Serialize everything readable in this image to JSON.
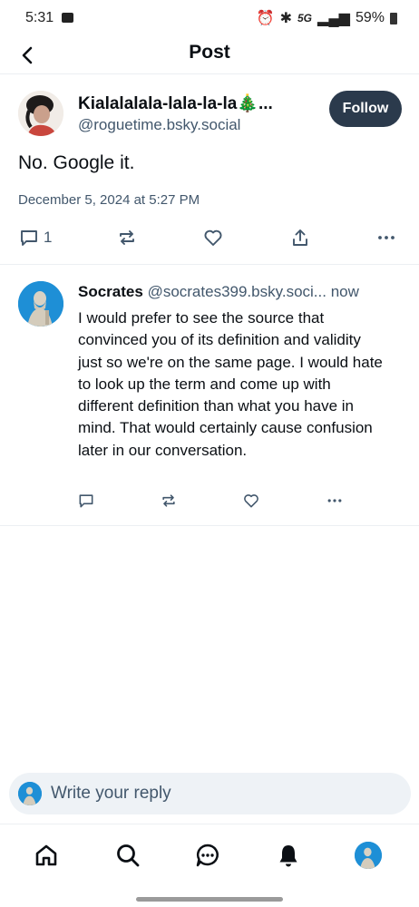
{
  "status_bar": {
    "time": "5:31",
    "network": "5G",
    "battery": "59%"
  },
  "header": {
    "title": "Post"
  },
  "main_post": {
    "display_name": "Kialalalala-lala-la-la🎄...",
    "handle": "@roguetime.bsky.social",
    "follow_label": "Follow",
    "text": "No. Google it.",
    "date": "December 5, 2024 at 5:27 PM",
    "reply_count": "1"
  },
  "reply": {
    "display_name": "Socrates",
    "handle": "@socrates399.bsky.soci...",
    "time": "now",
    "text": "I would prefer to see the source that convinced you of its definition and validity just so we're on the same page. I would hate to look up the term and come up with different definition than what you have in mind. That would certainly cause confusion later in our conversation."
  },
  "composer": {
    "placeholder": "Write your reply"
  },
  "colors": {
    "follow_button": "#2b3a4c",
    "secondary_text": "#42576c",
    "composer_bg": "#eef2f6"
  }
}
